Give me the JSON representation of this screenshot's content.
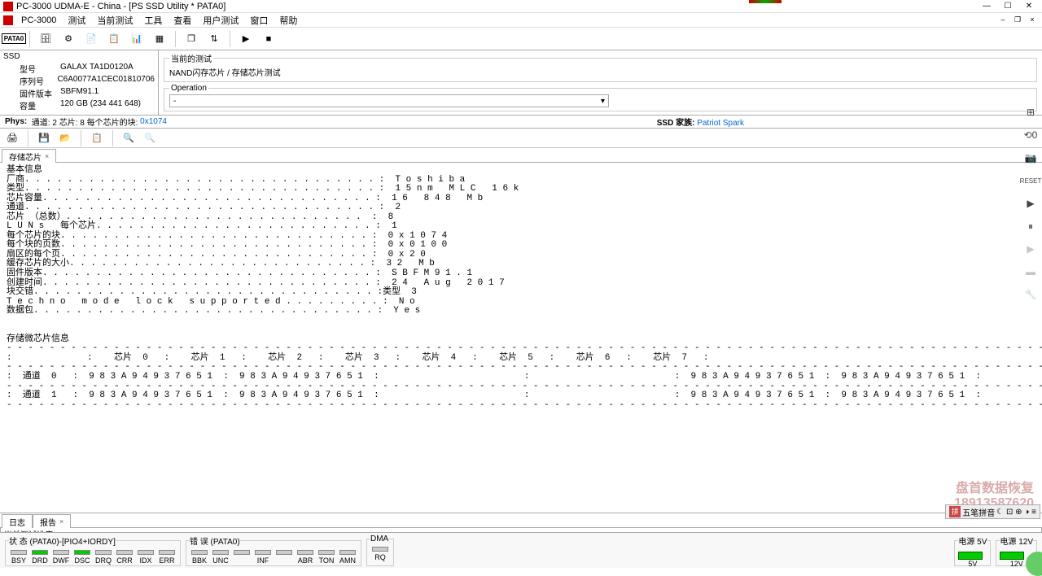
{
  "title": "PC-3000 UDMA-E - China - [PS SSD Utility * PATA0]",
  "menu": {
    "pc3000": "PC-3000",
    "test": "测试",
    "current": "当前测试",
    "tools": "工具",
    "view": "查看",
    "user": "用户测试",
    "window": "窗口",
    "help": "帮助"
  },
  "ssd": {
    "hdr": "SSD",
    "model_lbl": "型号",
    "model": "GALAX TA1D0120A",
    "serial_lbl": "序列号",
    "serial": "C6A0077A1CEC01810706",
    "fw_lbl": "固件版本",
    "fw": "SBFM91.1",
    "cap_lbl": "容量",
    "cap": "120 GB (234 441 648)"
  },
  "test_panel": {
    "legend": "当前的测试",
    "path": "NAND闪存芯片 / 存储芯片测试",
    "op_legend": "Operation",
    "op_value": "-"
  },
  "phys": {
    "label": "Phys:",
    "chan": "通道: 2",
    "chip": "芯片: 8",
    "blocks_lbl": "每个芯片的块:",
    "blocks": "0x1074",
    "ssd_fam_lbl": "SSD 家族:",
    "ssd_fam": "Patriot Spark"
  },
  "tab1": "存储芯片",
  "logtab1": "日志",
  "logtab2": "报告",
  "progress": "当前测试进度",
  "content": "基本信息\n厂商. . . . . . . . . . . . . . . . . . . . . . . . . . . . . . . . . :  T o s h i b a\n类型. . . . . . . . . . . . . . . . . . . . . . . . . . . . . . . . . :  1 5 n m   M L C   1 6 k\n芯片容量. . . . . . . . . . . . . . . . . . . . . . . . . . . . . . . :  1 6   8 4 8   M b\n通道. . . . . . . . . . . . . . . . . . . . . . . . . . . . . . . . . :  2\n芯片 （总数）. . . . . . . . . . . . . . . . . . . . . . . . . . . .  :  8\nL U N s   每个芯片. . . . . . . . . . . . . . . . . . . . . . . . . . :  1\n每个芯片的块. . . . . . . . . . . . . . . . . . . . . . . . . . . . . :  0 x 1 0 7 4\n每个块的页数. . . . . . . . . . . . . . . . . . . . . . . . . . . . . :  0 x 0 1 0 0\n扇区的每个页. . . . . . . . . . . . . . . . . . . . . . . . . . . . . :  0 x 2 0\n缓存芯片的大小. . . . . . . . . . . . . . . . . . . . . . . . . . . . :  3 2   M b\n固件版本. . . . . . . . . . . . . . . . . . . . . . . . . . . . . . . :  S B F M 9 1 . 1\n创建时间. . . . . . . . . . . . . . . . . . . . . . . . . . . . . . . :  2 4   A u g   2 0 1 7\n块交错. . . . . . . . . . . . . . . . . . . . . . . . . . . . . . . . :类型  3\nT e c h n o   m o d e   l o c k   s u p p o r t e d . . . . . . . . . :  N o\n数据包. . . . . . . . . . . . . . . . . . . . . . . . . . . . . . . . :  Y e s\n\n\n存储微芯片信息\n- - - - - - - - - - - - - - - - - - - - - - - - - - - - - - - - - - - - - - - - - - - - - - - - - - - - - - - - - - - - - - - - - - - - - - - - - - - - - - - - - - - - - - - - - - - - - - - - - - - - - - -\n:              :    芯片  0   :    芯片  1   :    芯片  2   :    芯片  3   :    芯片  4   :    芯片  5   :    芯片  6   :    芯片  7   :\n- - - - - - - - - - - - - - - - - - - - - - - - - - - - - - - - - - - - - - - - - - - - - - - - - - - - - - - - - - - - - - - - - - - - - - - - - - - - - - - - - - - - - - - - - - - - - - - - - - - - - - -\n:  通道  0   :  9 8 3 A 9 4 9 3 7 6 5 1  :  9 8 3 A 9 4 9 3 7 6 5 1  :                           :                           :  9 8 3 A 9 4 9 3 7 6 5 1  :  9 8 3 A 9 4 9 3 7 6 5 1  :                           :                           :\n- - - - - - - - - - - - - - - - - - - - - - - - - - - - - - - - - - - - - - - - - - - - - - - - - - - - - - - - - - - - - - - - - - - - - - - - - - - - - - - - - - - - - - - - - - - - - - - - - - - - - - -\n:  通道  1   :  9 8 3 A 9 4 9 3 7 6 5 1  :  9 8 3 A 9 4 9 3 7 6 5 1  :                           :                           :  9 8 3 A 9 4 9 3 7 6 5 1  :  9 8 3 A 9 4 9 3 7 6 5 1  :                           :                           :\n- - - - - - - - - - - - - - - - - - - - - - - - - - - - - - - - - - - - - - - - - - - - - - - - - - - - - - - - - - - - - - - - - - - - - - - - - - - - - - - - - - - - - - - - - - - - - - - - - - - - - - -",
  "watermark": {
    "l1": "盘首数据恢复",
    "l2": "18913587620"
  },
  "ime": "五笔拼音",
  "status": {
    "s1_legend": "状 态 (PATA0)-[PIO4+IORDY]",
    "s1": [
      "BSY",
      "DRD",
      "DWF",
      "DSC",
      "DRQ",
      "CRR",
      "IDX",
      "ERR"
    ],
    "s1_on": [
      false,
      true,
      false,
      true,
      false,
      false,
      false,
      false
    ],
    "s2_legend": "错 误 (PATA0)",
    "s2": [
      "BBK",
      "UNC",
      "",
      "INF",
      "",
      "ABR",
      "TON",
      "AMN"
    ],
    "s3_legend": "DMA",
    "s3": [
      "RQ"
    ],
    "p5": "电源 5V",
    "p5v": "5V",
    "p12": "电源 12V",
    "p12v": "12V"
  }
}
